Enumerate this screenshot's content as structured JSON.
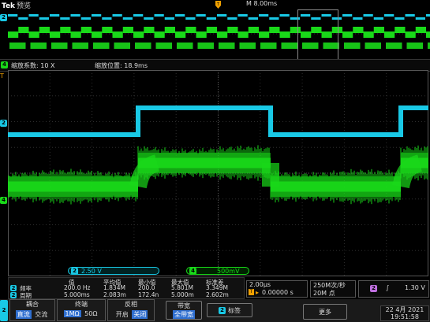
{
  "header": {
    "brand": "Tek",
    "mode": "预览",
    "time_position": "M 8.00ms"
  },
  "zoom_bar": {
    "factor_label": "缩放系数: 10 X",
    "position_label": "缩放位置: 18.9ms"
  },
  "channels": {
    "ch2_label": "2",
    "ch4_label": "4",
    "ch2_color": "#19c9e6",
    "ch4_color": "#19d919",
    "ch2_scale": "2.50 V",
    "ch4_scale": "500mV"
  },
  "measurements": {
    "headers": [
      "值",
      "平均值",
      "最小值",
      "最大值",
      "标准差"
    ],
    "rows": [
      {
        "badge": "2",
        "name": "频率",
        "values": [
          "200.0 Hz",
          "1.834M",
          "200.0",
          "5.801M",
          "3.349M"
        ]
      },
      {
        "badge": "2",
        "name": "周期",
        "values": [
          "5.000ms",
          "2.083m",
          "172.4n",
          "5.000m",
          "2.602m"
        ]
      }
    ]
  },
  "timebase": {
    "scale": "2.00μs",
    "trigger_pos": "0.00000 s",
    "sample_rate": "250M次/秒",
    "record": "20M 点"
  },
  "trigger": {
    "source": "2",
    "slope": "∫",
    "level": "1.30 V"
  },
  "menu": {
    "channel": "2",
    "coupling": {
      "title": "耦合",
      "options": [
        "直流",
        "交流"
      ],
      "selected": 0
    },
    "termination": {
      "title": "终端",
      "options": [
        "1MΩ",
        "50Ω"
      ],
      "selected": 0
    },
    "invert": {
      "title": "反相",
      "options": [
        "开启",
        "关闭"
      ],
      "selected": 1
    },
    "bandwidth": {
      "title": "带宽",
      "value": "全带宽"
    },
    "label_button": "标签",
    "more": "更多"
  },
  "datetime": {
    "date": "22 4月 2021",
    "time": "19:51:58"
  }
}
